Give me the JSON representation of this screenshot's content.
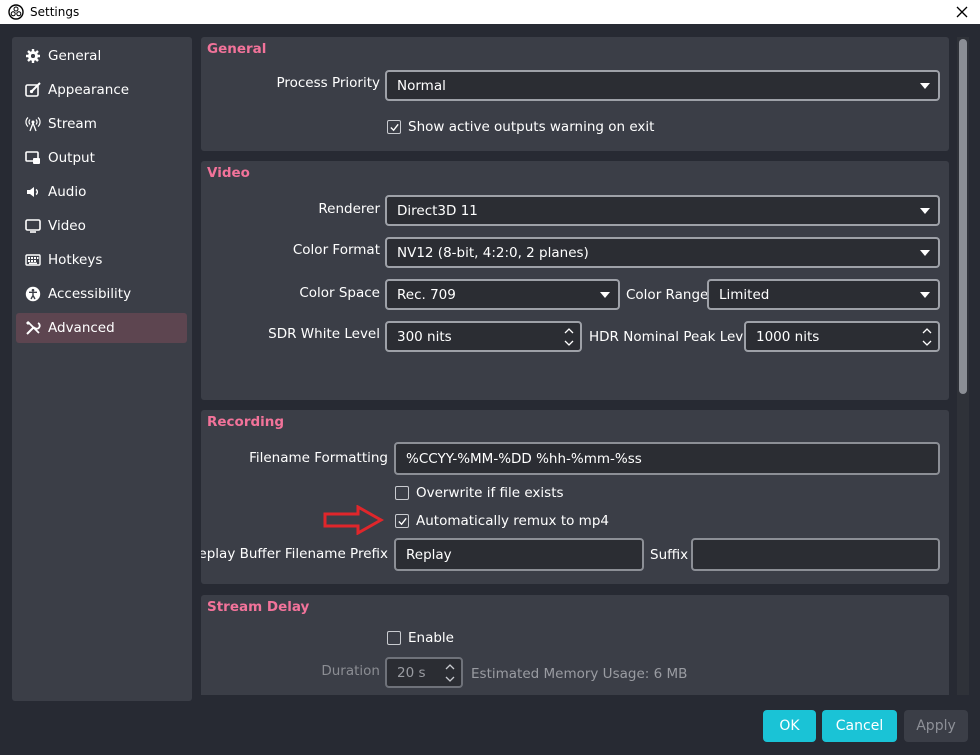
{
  "window": {
    "title": "Settings"
  },
  "sidebar": {
    "items": [
      {
        "label": "General",
        "icon": "gear-icon"
      },
      {
        "label": "Appearance",
        "icon": "appearance-icon"
      },
      {
        "label": "Stream",
        "icon": "antenna-icon"
      },
      {
        "label": "Output",
        "icon": "output-icon"
      },
      {
        "label": "Audio",
        "icon": "speaker-icon"
      },
      {
        "label": "Video",
        "icon": "monitor-icon"
      },
      {
        "label": "Hotkeys",
        "icon": "keyboard-icon"
      },
      {
        "label": "Accessibility",
        "icon": "accessibility-icon"
      },
      {
        "label": "Advanced",
        "icon": "tools-icon",
        "selected": true
      }
    ]
  },
  "general": {
    "title": "General",
    "process_priority_label": "Process Priority",
    "process_priority_value": "Normal",
    "show_warning_label": "Show active outputs warning on exit",
    "show_warning_checked": true
  },
  "video": {
    "title": "Video",
    "renderer_label": "Renderer",
    "renderer_value": "Direct3D 11",
    "color_format_label": "Color Format",
    "color_format_value": "NV12 (8-bit, 4:2:0, 2 planes)",
    "color_space_label": "Color Space",
    "color_space_value": "Rec. 709",
    "color_range_label": "Color Range",
    "color_range_value": "Limited",
    "sdr_white_label": "SDR White Level",
    "sdr_white_value": "300 nits",
    "hdr_peak_label": "HDR Nominal Peak Level",
    "hdr_peak_value": "1000 nits"
  },
  "recording": {
    "title": "Recording",
    "filename_format_label": "Filename Formatting",
    "filename_format_value": "%CCYY-%MM-%DD %hh-%mm-%ss",
    "overwrite_label": "Overwrite if file exists",
    "overwrite_checked": false,
    "remux_label": "Automatically remux to mp4",
    "remux_checked": true,
    "replay_prefix_label": "Replay Buffer Filename Prefix",
    "replay_prefix_value": "Replay",
    "suffix_label": "Suffix",
    "suffix_value": ""
  },
  "stream_delay": {
    "title": "Stream Delay",
    "enable_label": "Enable",
    "enable_checked": false,
    "duration_label": "Duration",
    "duration_value": "20 s",
    "memory_usage": "Estimated Memory Usage: 6 MB"
  },
  "buttons": {
    "ok": "OK",
    "cancel": "Cancel",
    "apply": "Apply"
  },
  "colors": {
    "accent": "#1ac3d6",
    "section_title": "#f2739a",
    "selected_item": "#5d4550",
    "annotation_arrow": "#e0262b"
  }
}
